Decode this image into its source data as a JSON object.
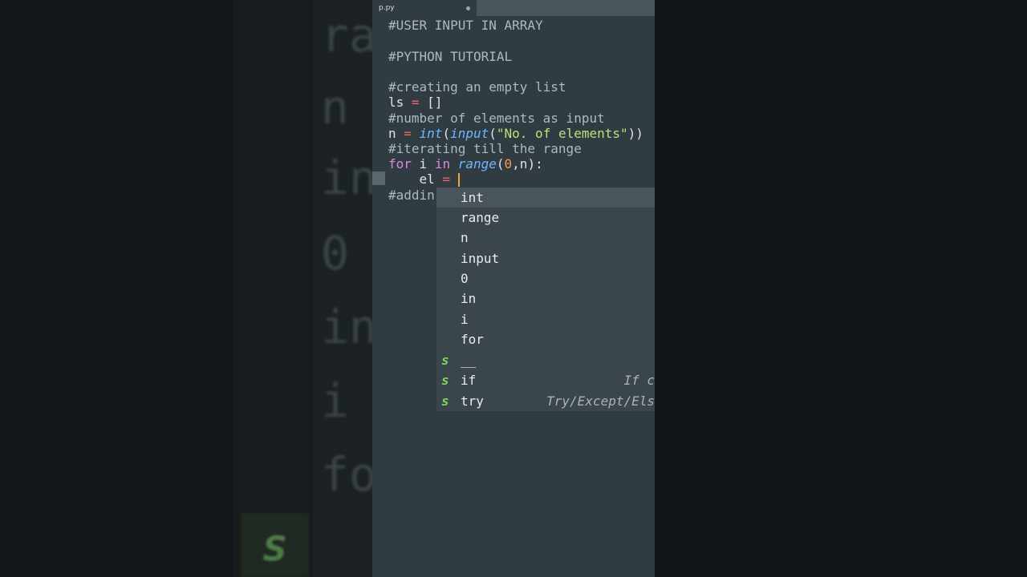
{
  "tab": {
    "filename": "p.py"
  },
  "code": {
    "l1": "#USER INPUT IN ARRAY",
    "l2": "#PYTHON TUTORIAL",
    "l3": "#creating an empty list",
    "l4_var": "ls",
    "l4_eq": " = ",
    "l4_val": "[]",
    "l5": "#number of elements as input",
    "l6_var": "n ",
    "l6_eq": "= ",
    "l6_fn1": "int",
    "l6_p1": "(",
    "l6_fn2": "input",
    "l6_p2": "(",
    "l6_str": "\"No. of elements\"",
    "l6_p3": "))",
    "l7": "#iterating till the range",
    "l8_for": "for",
    "l8_i": " i ",
    "l8_in": "in",
    "l8_sp": " ",
    "l8_fn": "range",
    "l8_p1": "(",
    "l8_zero": "0",
    "l8_rest": ",n):",
    "l9_var": "    el ",
    "l9_eq": "=",
    "l9_sp": " ",
    "l10": "#addin"
  },
  "autocomplete": {
    "items": [
      {
        "kind": "",
        "label": "int",
        "hint": ""
      },
      {
        "kind": "",
        "label": "range",
        "hint": ""
      },
      {
        "kind": "",
        "label": "n",
        "hint": ""
      },
      {
        "kind": "",
        "label": "input",
        "hint": ""
      },
      {
        "kind": "",
        "label": "0",
        "hint": ""
      },
      {
        "kind": "",
        "label": "in",
        "hint": ""
      },
      {
        "kind": "",
        "label": "i",
        "hint": ""
      },
      {
        "kind": "",
        "label": "for",
        "hint": ""
      },
      {
        "kind": "s",
        "label": "__",
        "hint": ""
      },
      {
        "kind": "s",
        "label": "if",
        "hint": "If c"
      },
      {
        "kind": "s",
        "label": "try",
        "hint": "Try/Except/Els"
      }
    ]
  },
  "background": {
    "words": [
      "ra",
      "n",
      "in",
      "0",
      "in",
      "i",
      "fo"
    ],
    "s_badge": "s"
  },
  "colors": {
    "editor_bg": "#303c42",
    "popup_bg": "#3a464c",
    "keyword": "#d889e0",
    "function": "#6fb8ff",
    "string": "#b9e17c",
    "number": "#f19c4b",
    "operator": "#e76a6a",
    "snippet": "#7ed957"
  }
}
